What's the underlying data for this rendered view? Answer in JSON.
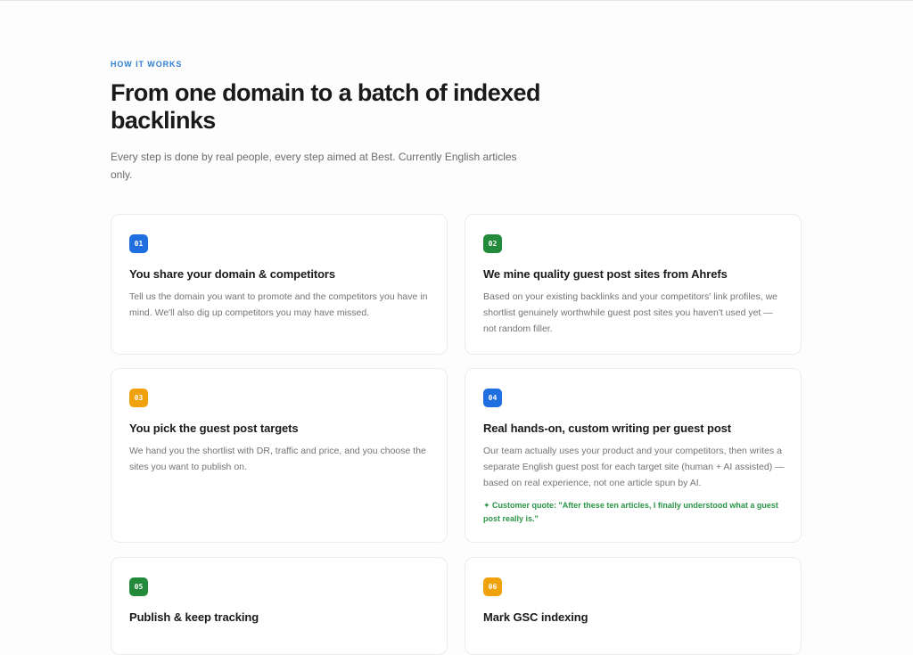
{
  "header": {
    "eyebrow": "HOW IT WORKS",
    "title": "From one domain to a batch of indexed backlinks",
    "subtitle": "Every step is done by real people, every step aimed at Best. Currently English articles only."
  },
  "colors": {
    "blue": "#1f6fe0",
    "green": "#238a3c",
    "orange": "#f0a20c",
    "eyebrow": "#2f7fd3",
    "quote": "#2b9648"
  },
  "steps": [
    {
      "number": "01",
      "color": "blue",
      "title": "You share your domain & competitors",
      "description": "Tell us the domain you want to promote and the competitors you have in mind. We'll also dig up competitors you may have missed."
    },
    {
      "number": "02",
      "color": "green",
      "title": "We mine quality guest post sites from Ahrefs",
      "description": "Based on your existing backlinks and your competitors' link profiles, we shortlist genuinely worthwhile guest post sites you haven't used yet — not random filler."
    },
    {
      "number": "03",
      "color": "orange",
      "title": "You pick the guest post targets",
      "description": "We hand you the shortlist with DR, traffic and price, and you choose the sites you want to publish on."
    },
    {
      "number": "04",
      "color": "blue",
      "title": "Real hands-on, custom writing per guest post",
      "description": "Our team actually uses your product and your competitors, then writes a separate English guest post for each target site (human + AI assisted) — based on real experience, not one article spun by AI.",
      "quote": "✦ Customer quote: \"After these ten articles, I finally understood what a guest post really is.\""
    },
    {
      "number": "05",
      "color": "green",
      "title": "Publish & keep tracking",
      "description": ""
    },
    {
      "number": "06",
      "color": "orange",
      "title": "Mark GSC indexing",
      "description": ""
    }
  ]
}
